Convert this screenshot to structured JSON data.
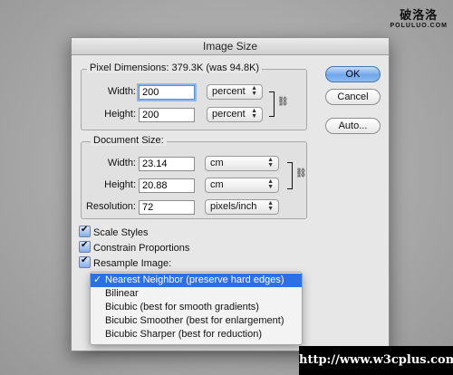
{
  "site_logo": {
    "chinese": "破洛洛",
    "latin": "POLULUO.COM"
  },
  "dialog": {
    "title": "Image Size",
    "pixel_dimensions": {
      "title": "Pixel Dimensions:  379.3K (was 94.8K)",
      "width_label": "Width:",
      "width_value": "200",
      "width_unit": "percent",
      "height_label": "Height:",
      "height_value": "200",
      "height_unit": "percent"
    },
    "document_size": {
      "title": "Document Size:",
      "width_label": "Width:",
      "width_value": "23.14",
      "width_unit": "cm",
      "height_label": "Height:",
      "height_value": "20.88",
      "height_unit": "cm",
      "resolution_label": "Resolution:",
      "resolution_value": "72",
      "resolution_unit": "pixels/inch"
    },
    "buttons": {
      "ok": "OK",
      "cancel": "Cancel",
      "auto": "Auto..."
    },
    "options": {
      "scale_styles": "Scale Styles",
      "constrain_proportions": "Constrain Proportions",
      "resample_image": "Resample Image:"
    },
    "resample_menu": {
      "tick": "✓",
      "items": [
        "Nearest Neighbor (preserve hard edges)",
        "Bilinear",
        "Bicubic (best for smooth gradients)",
        "Bicubic Smoother (best for enlargement)",
        "Bicubic Sharper (best for reduction)"
      ]
    }
  },
  "watermark": "http://www.w3cplus.com"
}
